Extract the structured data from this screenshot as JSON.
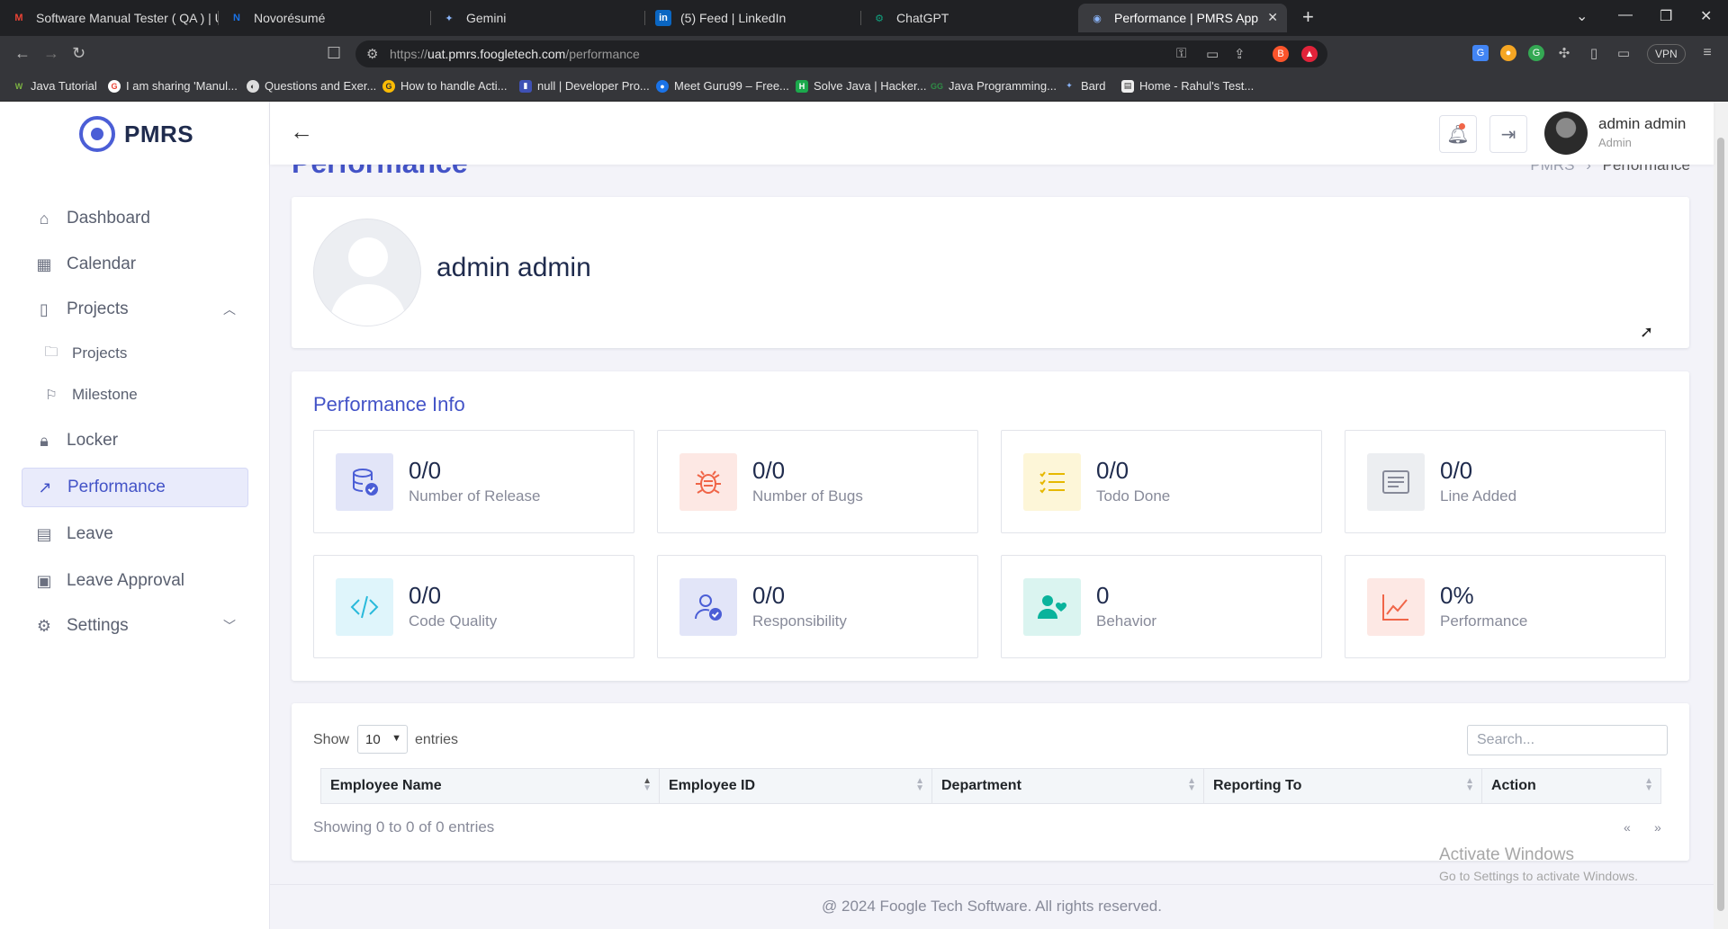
{
  "browser": {
    "tabs": [
      {
        "title": "Software Manual Tester ( QA ) | Umr...",
        "icon": "gmail-icon",
        "color": "#ea4335"
      },
      {
        "title": "Novorésumé",
        "icon": "novoresume-icon",
        "color": "#1a73e8"
      },
      {
        "title": "Gemini",
        "icon": "gemini-icon",
        "color": "#8ab4f8"
      },
      {
        "title": "(5) Feed | LinkedIn",
        "icon": "linkedin-icon",
        "color": "#0a66c2"
      },
      {
        "title": "ChatGPT",
        "icon": "chatgpt-icon",
        "color": "#10a37f"
      },
      {
        "title": "Performance | PMRS App",
        "icon": "pmrs-icon",
        "color": "#4b5ed6"
      }
    ],
    "url_prefix": "https://",
    "url_host": "uat.pmrs.foogletech.com",
    "url_path": "/performance",
    "vpn_label": "VPN",
    "bookmarks": [
      {
        "label": "Java Tutorial",
        "color": "#2e7d32"
      },
      {
        "label": "I am sharing 'Manul...",
        "color": "#ea4335"
      },
      {
        "label": "Questions and Exer...",
        "color": "#666666"
      },
      {
        "label": "How to handle Acti...",
        "color": "#ea4335"
      },
      {
        "label": "null | Developer Pro...",
        "color": "#3f51b5"
      },
      {
        "label": "Meet Guru99 – Free...",
        "color": "#1a73e8"
      },
      {
        "label": "Solve Java | Hacker...",
        "color": "#1ba94c"
      },
      {
        "label": "Java Programming...",
        "color": "#2f8d46"
      },
      {
        "label": "Bard",
        "color": "#8ab4f8"
      },
      {
        "label": "Home - Rahul's Test...",
        "color": "#9e9e9e"
      }
    ]
  },
  "app": {
    "logo_text": "PMRS",
    "sidebar": {
      "items": [
        {
          "label": "Dashboard",
          "icon": "home-icon"
        },
        {
          "label": "Calendar",
          "icon": "calendar-icon"
        },
        {
          "label": "Projects",
          "icon": "projects-icon"
        },
        {
          "label": "Locker",
          "icon": "lock-icon"
        },
        {
          "label": "Performance",
          "icon": "external-link-icon"
        },
        {
          "label": "Leave",
          "icon": "leave-icon"
        },
        {
          "label": "Leave Approval",
          "icon": "leave-approval-icon"
        },
        {
          "label": "Settings",
          "icon": "gear-icon"
        }
      ],
      "sub_items": [
        {
          "label": "Projects",
          "icon": "folder-icon"
        },
        {
          "label": "Milestone",
          "icon": "flag-icon"
        }
      ],
      "active": "Performance"
    },
    "header": {
      "user_name": "admin admin",
      "user_role": "Admin"
    },
    "page_title": "Performance",
    "breadcrumb": {
      "root": "PMRS",
      "separator": "›",
      "current": "Performance"
    },
    "profile": {
      "name": "admin admin"
    },
    "performance_info": {
      "title": "Performance Info",
      "stats": [
        {
          "value": "0/0",
          "label": "Number of Release",
          "icon": "database-check-icon",
          "color": "#4b5ed6",
          "bg": "#e2e5f8"
        },
        {
          "value": "0/0",
          "label": "Number of Bugs",
          "icon": "bug-icon",
          "color": "#f06548",
          "bg": "#fde8e4"
        },
        {
          "value": "0/0",
          "label": "Todo Done",
          "icon": "list-check-icon",
          "color": "#e6b800",
          "bg": "#fdf6d8"
        },
        {
          "value": "0/0",
          "label": "Line Added",
          "icon": "text-lines-icon",
          "color": "#878a99",
          "bg": "#eceef1"
        },
        {
          "value": "0/0",
          "label": "Code Quality",
          "icon": "code-icon",
          "color": "#29badb",
          "bg": "#dff5fb"
        },
        {
          "value": "0/0",
          "label": "Responsibility",
          "icon": "user-check-icon",
          "color": "#4b5ed6",
          "bg": "#e2e5f8"
        },
        {
          "value": "0",
          "label": "Behavior",
          "icon": "user-heart-icon",
          "color": "#0ab39c",
          "bg": "#daf4f0"
        },
        {
          "value": "0%",
          "label": "Performance",
          "icon": "line-chart-icon",
          "color": "#f06548",
          "bg": "#fde8e4"
        }
      ]
    },
    "table": {
      "show_label": "Show",
      "page_size": "10",
      "entries_label": "entries",
      "search_placeholder": "Search...",
      "columns": [
        "Employee Name",
        "Employee ID",
        "Department",
        "Reporting To",
        "Action"
      ],
      "rows": [],
      "info": "Showing 0 to 0 of 0 entries",
      "prev": "«",
      "next": "»"
    },
    "footer": "@ 2024 Foogle Tech Software. All rights reserved."
  },
  "overlay": {
    "activate_title": "Activate Windows",
    "activate_sub": "Go to Settings to activate Windows."
  }
}
